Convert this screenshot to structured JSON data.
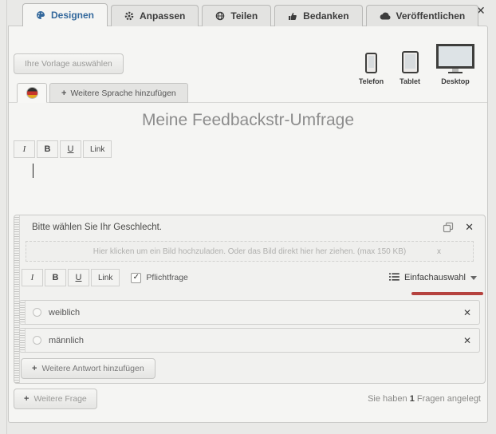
{
  "window": {
    "close": "✕"
  },
  "tabs": [
    {
      "label": "Designen"
    },
    {
      "label": "Anpassen"
    },
    {
      "label": "Teilen"
    },
    {
      "label": "Bedanken"
    },
    {
      "label": "Veröffentlichen"
    }
  ],
  "toolbar_top": {
    "template_button": "Ihre Vorlage auswählen"
  },
  "devices": [
    {
      "label": "Telefon"
    },
    {
      "label": "Tablet"
    },
    {
      "label": "Desktop"
    }
  ],
  "languages": {
    "add_label": "Weitere Sprache hinzufügen"
  },
  "survey": {
    "title": "Meine Feedbackstr-Umfrage"
  },
  "format_toolbar": {
    "italic": "I",
    "bold": "B",
    "underline": "U",
    "link": "Link"
  },
  "question": {
    "text": "Bitte wählen Sie Ihr Geschlecht.",
    "close": "✕",
    "upload_hint": "Hier klicken um ein Bild hochzuladen. Oder das Bild direkt hier her ziehen. (max 150 KB)",
    "upload_close": "x",
    "mandatory_label": "Pflichtfrage",
    "type_label": "Einfachauswahl",
    "answers": [
      {
        "label": "weiblich",
        "remove": "✕"
      },
      {
        "label": "männlich",
        "remove": "✕"
      }
    ],
    "add_answer_label": "Weitere Antwort hinzufügen"
  },
  "footer": {
    "add_question_label": "Weitere Frage",
    "status_prefix": "Sie haben",
    "status_count": "1",
    "status_suffix": "Fragen angelegt"
  },
  "ui": {
    "plus": "+",
    "check": "✓"
  },
  "colors": {
    "accent_blue": "#33689c",
    "underline_red": "#b5423e"
  }
}
